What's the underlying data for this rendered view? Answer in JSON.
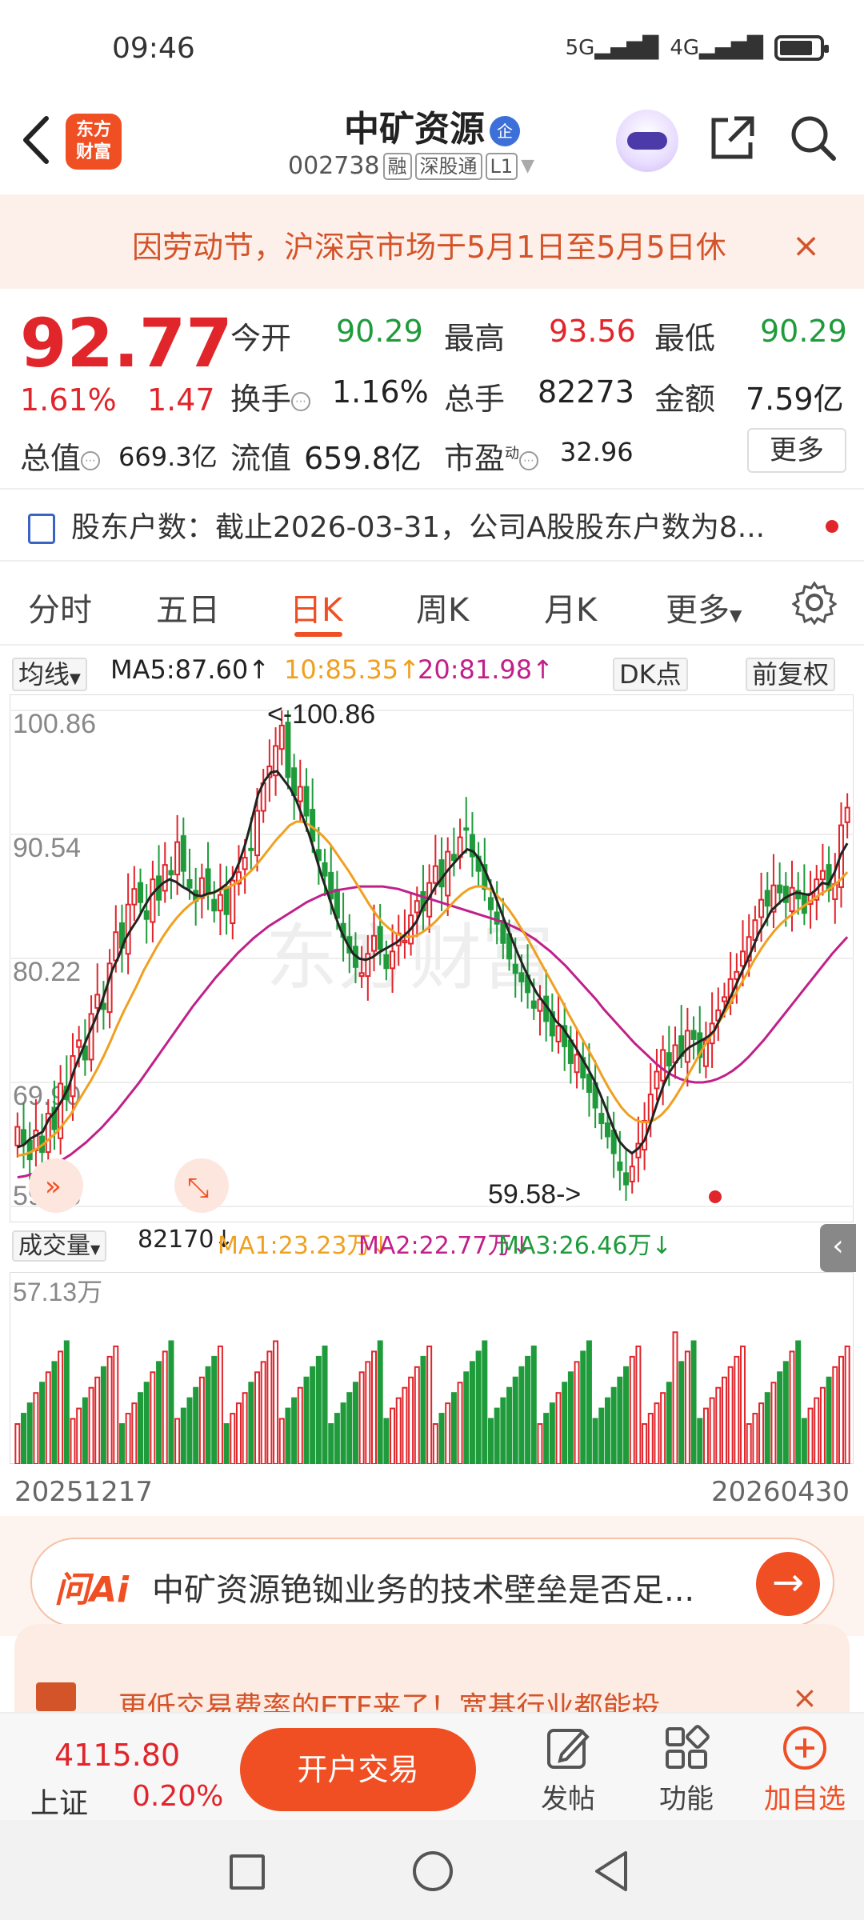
{
  "status": {
    "time": "09:46",
    "net1": "5G",
    "net2": "4G"
  },
  "header": {
    "logo_line1": "东方",
    "logo_line2": "财富",
    "title": "中矿资源",
    "title_badge": "企",
    "code": "002738",
    "tag1": "融",
    "tag2": "深股通",
    "tag3": "L1"
  },
  "notice": {
    "text": "因劳动节，沪深京市场于5月1日至5月5日休",
    "close": "×"
  },
  "quote": {
    "price": "92.77",
    "change_pct": "1.61%",
    "change": "1.47",
    "open_label": "今开",
    "open": "90.29",
    "high_label": "最高",
    "high": "93.56",
    "low_label": "最低",
    "low": "90.29",
    "turnover_label": "换手",
    "turnover": "1.16%",
    "volume_label": "总手",
    "volume": "82273",
    "amount_label": "金额",
    "amount": "7.59亿",
    "mcap_label": "总值",
    "mcap": "669.3亿",
    "float_label": "流值",
    "float": "659.8亿",
    "pe_label": "市盈",
    "pe_sup": "动",
    "pe": "32.96",
    "more": "更多"
  },
  "holder": {
    "text": "股东户数：截止2026-03-31，公司A股股东户数为8..."
  },
  "tabs": [
    "分时",
    "五日",
    "日K",
    "周K",
    "月K",
    "更多"
  ],
  "ma": {
    "selector": "均线",
    "ma5": "MA5:87.60↑",
    "ma10": "10:85.35↑",
    "ma20": "20:81.98↑",
    "dk": "DK点",
    "adjust": "前复权"
  },
  "chart_data": {
    "type": "candlestick",
    "y_ticks": [
      "100.86",
      "90.54",
      "80.22",
      "69.90",
      "59.58"
    ],
    "ylim": [
      59.58,
      100.86
    ],
    "max_label": "<-100.86",
    "min_label": "59.58->",
    "watermark": "东方财富",
    "colors": {
      "up": "#e0252b",
      "down": "#1f9b3b",
      "ma5": "#222222",
      "ma10": "#f0a020",
      "ma20": "#c0208a"
    },
    "close": [
      66.2,
      64.8,
      63.5,
      65.9,
      64.1,
      67.3,
      66.0,
      69.8,
      68.5,
      72.1,
      73.4,
      71.8,
      75.6,
      77.2,
      76.0,
      79.8,
      82.4,
      81.1,
      84.7,
      86.0,
      84.9,
      83.5,
      86.8,
      85.1,
      88.0,
      87.2,
      89.9,
      87.5,
      86.1,
      85.0,
      86.9,
      85.6,
      84.2,
      85.5,
      83.9,
      86.7,
      87.4,
      88.6,
      89.3,
      92.5,
      94.8,
      96.2,
      97.9,
      99.6,
      95.3,
      93.8,
      94.5,
      92.1,
      90.0,
      88.4,
      87.1,
      85.2,
      83.6,
      82.0,
      80.7,
      79.5,
      79.0,
      80.6,
      82.1,
      81.0,
      79.4,
      80.8,
      82.3,
      81.7,
      83.8,
      85.0,
      84.2,
      86.5,
      87.9,
      86.2,
      89.1,
      88.4,
      90.3,
      91.0,
      88.7,
      87.5,
      86.0,
      84.3,
      83.1,
      81.5,
      80.2,
      79.0,
      78.3,
      77.4,
      76.1,
      76.8,
      75.0,
      73.8,
      74.6,
      72.9,
      71.5,
      72.2,
      70.3,
      69.1,
      67.8,
      66.5,
      65.4,
      64.0,
      62.6,
      61.4,
      62.9,
      64.8,
      66.7,
      68.9,
      70.8,
      72.6,
      71.3,
      73.0,
      72.1,
      74.2,
      73.5,
      72.0,
      73.4,
      74.8,
      75.9,
      77.0,
      78.5,
      79.1,
      80.8,
      82.0,
      83.4,
      85.1,
      84.6,
      86.3,
      85.7,
      84.9,
      86.1,
      85.2,
      84.0,
      85.6,
      86.8,
      87.5,
      85.9,
      86.4,
      91.3,
      92.77
    ],
    "ma5": [
      64.5,
      64.7,
      65.2,
      65.5,
      65.8,
      66.9,
      67.5,
      68.4,
      69.4,
      71.0,
      72.3,
      73.6,
      74.8,
      76.1,
      77.7,
      79.3,
      80.4,
      81.8,
      82.7,
      83.5,
      84.5,
      85.4,
      86.0,
      86.5,
      86.8,
      86.6,
      86.2,
      85.9,
      85.5,
      85.4,
      85.6,
      85.7,
      86.0,
      86.4,
      87.0,
      88.2,
      89.8,
      91.8,
      93.9,
      95.0,
      95.7,
      95.8,
      95.1,
      94.4,
      93.4,
      92.0,
      90.6,
      88.9,
      87.1,
      85.6,
      84.0,
      82.6,
      81.5,
      80.6,
      80.2,
      80.1,
      80.3,
      80.7,
      81.0,
      81.3,
      81.6,
      82.1,
      82.6,
      83.3,
      84.5,
      85.3,
      86.2,
      86.9,
      87.6,
      88.2,
      88.8,
      89.3,
      89.1,
      88.4,
      87.3,
      86.0,
      84.6,
      83.2,
      81.9,
      80.6,
      79.4,
      78.3,
      77.3,
      76.6,
      75.9,
      75.0,
      74.5,
      73.7,
      72.9,
      72.0,
      71.1,
      70.1,
      68.9,
      67.6,
      66.2,
      65.0,
      64.4,
      64.0,
      64.4,
      65.1,
      66.6,
      68.2,
      69.7,
      70.8,
      71.6,
      72.3,
      72.8,
      73.1,
      73.4,
      73.7,
      74.2,
      75.3,
      76.4,
      77.5,
      78.7,
      79.8,
      81.0,
      82.3,
      83.2,
      84.2,
      84.7,
      85.2,
      85.5,
      85.7,
      85.6,
      85.5,
      85.9,
      86.5,
      86.4,
      87.4,
      88.9,
      89.8
    ],
    "ma10": [
      63.8,
      63.9,
      64.1,
      64.4,
      64.8,
      65.3,
      65.8,
      66.5,
      67.2,
      68.2,
      69.1,
      70.0,
      71.0,
      72.1,
      73.3,
      74.6,
      75.8,
      76.9,
      78.0,
      79.2,
      80.2,
      81.2,
      82.1,
      82.9,
      83.6,
      84.2,
      84.7,
      85.1,
      85.4,
      85.6,
      85.8,
      86.0,
      86.2,
      86.5,
      86.9,
      87.4,
      88.0,
      88.7,
      89.4,
      90.1,
      90.7,
      91.3,
      91.6,
      91.6,
      91.3,
      90.9,
      90.4,
      89.8,
      89.0,
      88.2,
      87.4,
      86.5,
      85.6,
      84.7,
      83.9,
      83.2,
      82.7,
      82.3,
      82.1,
      82.0,
      82.1,
      82.4,
      82.8,
      83.3,
      83.9,
      84.5,
      85.1,
      85.6,
      86.0,
      86.2,
      86.2,
      86.0,
      85.6,
      85.0,
      84.3,
      83.5,
      82.6,
      81.7,
      80.7,
      79.7,
      78.7,
      77.7,
      76.7,
      75.6,
      74.6,
      73.6,
      72.6,
      71.6,
      70.5,
      69.5,
      68.6,
      67.8,
      67.2,
      66.8,
      66.6,
      66.6,
      66.8,
      67.2,
      67.8,
      68.6,
      69.5,
      70.5,
      71.5,
      72.5,
      73.4,
      74.3,
      75.2,
      76.1,
      77.1,
      78.1,
      79.1,
      80.1,
      81.0,
      81.8,
      82.5,
      83.1,
      83.6,
      84.0,
      84.4,
      84.8,
      85.2,
      85.6,
      85.9,
      86.3,
      86.8,
      87.4
    ],
    "ma20": [
      62.0,
      62.1,
      62.3,
      62.5,
      62.8,
      63.1,
      63.5,
      63.9,
      64.4,
      64.9,
      65.5,
      66.1,
      66.8,
      67.5,
      68.3,
      69.1,
      69.9,
      70.8,
      71.7,
      72.6,
      73.5,
      74.4,
      75.3,
      76.2,
      77.0,
      77.8,
      78.6,
      79.3,
      80.0,
      80.7,
      81.3,
      81.9,
      82.4,
      82.9,
      83.3,
      83.7,
      84.1,
      84.5,
      84.9,
      85.2,
      85.5,
      85.7,
      85.9,
      86.0,
      86.1,
      86.2,
      86.2,
      86.2,
      86.2,
      86.1,
      86.0,
      85.8,
      85.6,
      85.4,
      85.2,
      85.0,
      84.8,
      84.6,
      84.4,
      84.2,
      84.0,
      83.8,
      83.6,
      83.4,
      83.2,
      82.9,
      82.6,
      82.2,
      81.8,
      81.3,
      80.8,
      80.2,
      79.6,
      78.9,
      78.2,
      77.5,
      76.8,
      76.0,
      75.3,
      74.6,
      73.9,
      73.2,
      72.6,
      72.0,
      71.4,
      70.9,
      70.5,
      70.2,
      70.0,
      69.9,
      69.9,
      70.0,
      70.2,
      70.5,
      70.9,
      71.4,
      72.0,
      72.7,
      73.4,
      74.2,
      75.0,
      75.8,
      76.6,
      77.4,
      78.2,
      79.0,
      79.8,
      80.6,
      81.3,
      82.0
    ]
  },
  "volume": {
    "selector": "成交量",
    "val": "82170↓",
    "ma1": "MA1:23.23万↓",
    "ma2": "MA2:22.77万↓",
    "ma3": "MA3:26.46万↓",
    "y_top": "57.13万",
    "date_start": "20251217",
    "date_end": "20260430"
  },
  "ai": {
    "logo": "问Ai",
    "text": "中矿资源铯铷业务的技术壁垒是否足..."
  },
  "ad": {
    "text": "更低交易费率的ETF来了！宽基行业都能投"
  },
  "bottom": {
    "index_value": "4115.80",
    "index_name": "上证",
    "index_pct": "0.20%",
    "trade": "开户交易",
    "post": "发帖",
    "func": "功能",
    "watch": "加自选"
  }
}
